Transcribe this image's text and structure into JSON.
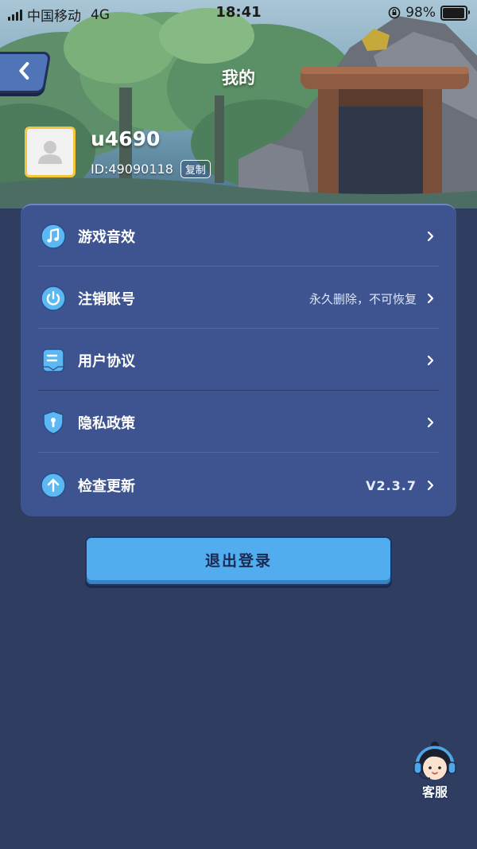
{
  "status_bar": {
    "carrier": "中国移动",
    "network": "4G",
    "time": "18:41",
    "battery_percent": "98%",
    "battery_level": 0.98,
    "lock_icon": "rotation-lock-icon"
  },
  "header": {
    "title": "我的",
    "back_icon": "chevron-left-icon"
  },
  "profile": {
    "username": "u4690",
    "user_id": "ID:49090118",
    "copy_label": "复制",
    "avatar_icon": "default-avatar-icon"
  },
  "menu": {
    "items": [
      {
        "label": "游戏音效",
        "hint": "",
        "icon": "music-note-icon"
      },
      {
        "label": "注销账号",
        "hint": "永久删除，不可恢复",
        "icon": "power-icon"
      },
      {
        "label": "用户协议",
        "hint": "",
        "icon": "document-icon"
      },
      {
        "label": "隐私政策",
        "hint": "",
        "icon": "shield-icon"
      },
      {
        "label": "检查更新",
        "hint": "V2.3.7",
        "icon": "arrow-up-icon"
      }
    ]
  },
  "logout": {
    "label": "退出登录"
  },
  "service": {
    "label": "客服",
    "icon": "customer-service-icon"
  },
  "colors": {
    "page_background": "#2f3d61",
    "card_background": "#3e5490",
    "button_blue": "#52adee",
    "avatar_border": "#f4c63c",
    "icon_blue": "#5cb8f2"
  }
}
